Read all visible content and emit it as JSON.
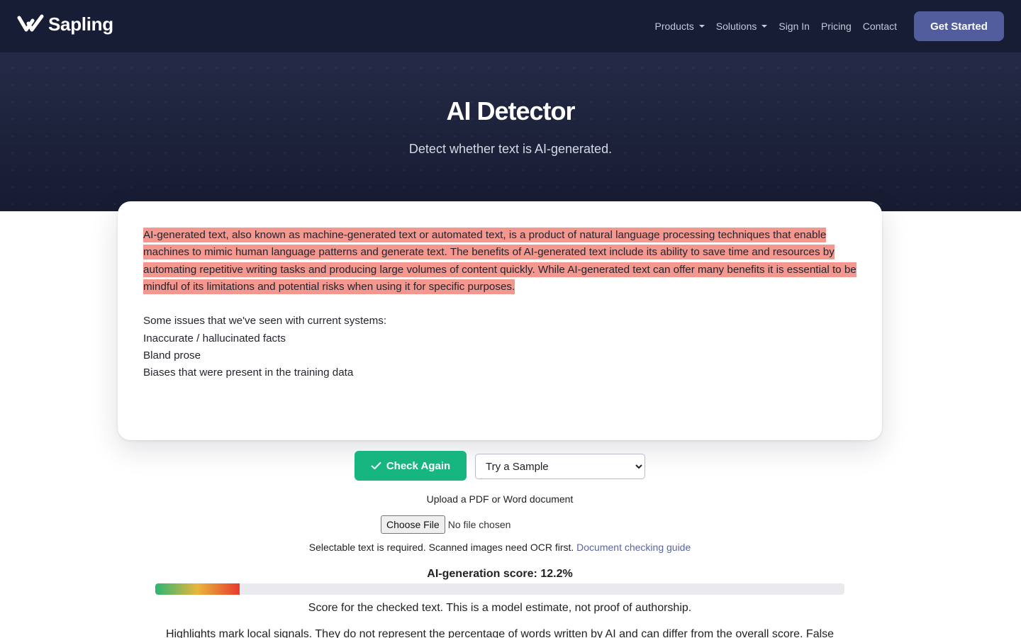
{
  "header": {
    "brand": "Sapling",
    "nav": [
      {
        "label": "Products",
        "dropdown": true
      },
      {
        "label": "Solutions",
        "dropdown": true
      },
      {
        "label": "Sign In",
        "dropdown": false
      },
      {
        "label": "Pricing",
        "dropdown": false
      },
      {
        "label": "Contact",
        "dropdown": false
      }
    ],
    "cta_label": "Get Started"
  },
  "hero": {
    "title": "AI Detector",
    "subtitle": "Detect whether text is AI-generated."
  },
  "editor": {
    "highlighted_paragraph": "AI-generated text, also known as machine-generated text or automated text, is a product of natural language processing techniques that enable machines to mimic human language patterns and generate text. The benefits of AI-generated text include its ability to save time and resources by automating repetitive writing tasks and producing large volumes of content quickly. While AI-generated text can offer many benefits it is essential to be mindful of its limitations and potential risks when using it for specific purposes.",
    "lines": [
      "Some issues that we've seen with current systems:",
      "Inaccurate / hallucinated facts",
      "Bland prose",
      "Biases that were present in the training data"
    ]
  },
  "actions": {
    "check_label": "Check Again",
    "sample_select": {
      "selected": "Try a Sample"
    }
  },
  "upload": {
    "label": "Upload a PDF or Word document",
    "button_label": "Choose File",
    "status": "No file chosen",
    "note": "Selectable text is required. Scanned images need OCR first.",
    "guide_link": "Document checking guide"
  },
  "score": {
    "title": "AI-generation score: 12.2%",
    "value_percent": 12.2,
    "description": "Score for the checked text. This is a model estimate, not proof of authorship.",
    "highlight_note": "Highlights mark local signals. They do not represent the percentage of words written by AI and can differ from the overall score. False"
  },
  "colors": {
    "nav_bg": "#181d36",
    "cta_bg": "#525d9e",
    "check_button": "#17b580",
    "highlight": "#f3978f",
    "link": "#5a64a0"
  },
  "icons": {
    "logo": "sapling-check-logo-icon",
    "check": "checkmark-icon",
    "caret": "caret-down-icon"
  }
}
